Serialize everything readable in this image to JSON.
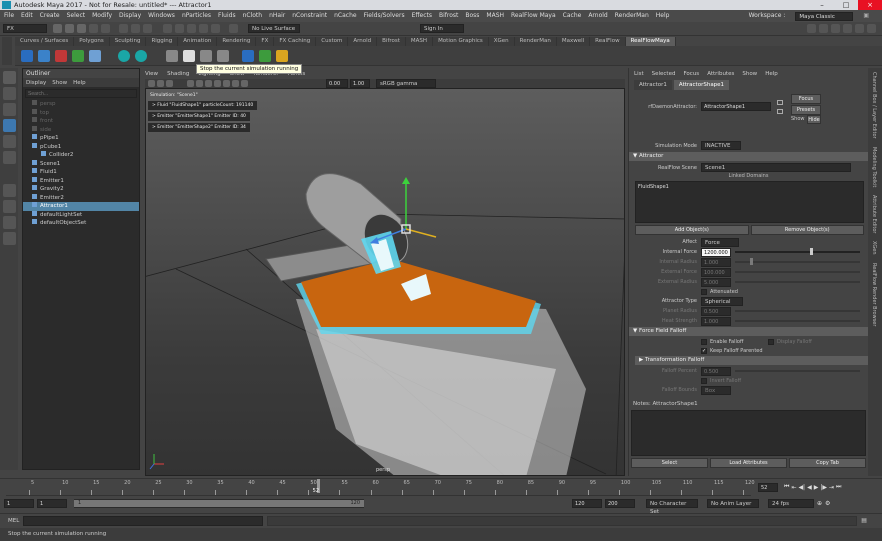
{
  "window": {
    "title": "Autodesk Maya 2017 - Not for Resale: untitled* --- Attractor1"
  },
  "menubar": [
    "File",
    "Edit",
    "Create",
    "Select",
    "Modify",
    "Display",
    "Windows",
    "nParticles",
    "Fluids",
    "nCloth",
    "nHair",
    "nConstraint",
    "nCache",
    "Fields/Solvers",
    "Effects",
    "Bifrost",
    "Boss",
    "MASH",
    "RealFlow Maya",
    "Cache",
    "Arnold",
    "RenderMan",
    "Help"
  ],
  "workspace": {
    "label": "Workspace :",
    "value": "Maya Classic"
  },
  "statusline": {
    "mode": "FX",
    "live_surface": "No Live Surface",
    "sign_in": "Sign In"
  },
  "shelf_tabs": [
    "Curves / Surfaces",
    "Polygons",
    "Sculpting",
    "Rigging",
    "Animation",
    "Rendering",
    "FX",
    "FX Caching",
    "Custom",
    "Arnold",
    "Bifrost",
    "MASH",
    "Motion Graphics",
    "XGen",
    "RenderMan",
    "Maxwell",
    "RealFlow",
    "RealFlowMaya"
  ],
  "shelf_active_tab": "RealFlowMaya",
  "tooltip": "Stop the current simulation running",
  "outliner": {
    "title": "Outliner",
    "menu": [
      "Display",
      "Show",
      "Help"
    ],
    "search_placeholder": "Search...",
    "items": [
      {
        "label": "persp",
        "indent": 1,
        "state": "dim"
      },
      {
        "label": "top",
        "indent": 1,
        "state": "dim"
      },
      {
        "label": "front",
        "indent": 1,
        "state": "dim"
      },
      {
        "label": "side",
        "indent": 1,
        "state": "dim"
      },
      {
        "label": "pPipe1",
        "indent": 1,
        "state": ""
      },
      {
        "label": "pCube1",
        "indent": 1,
        "state": ""
      },
      {
        "label": "Collider2",
        "indent": 2,
        "state": ""
      },
      {
        "label": "Scene1",
        "indent": 1,
        "state": ""
      },
      {
        "label": "Fluid1",
        "indent": 1,
        "state": ""
      },
      {
        "label": "Emitter1",
        "indent": 1,
        "state": ""
      },
      {
        "label": "Gravity2",
        "indent": 1,
        "state": ""
      },
      {
        "label": "Emitter2",
        "indent": 1,
        "state": ""
      },
      {
        "label": "Attractor1",
        "indent": 1,
        "state": "sel"
      },
      {
        "label": "defaultLightSet",
        "indent": 1,
        "state": ""
      },
      {
        "label": "defaultObjectSet",
        "indent": 1,
        "state": ""
      }
    ]
  },
  "viewport": {
    "menu": [
      "View",
      "Shading",
      "Lighting",
      "Show",
      "Renderer",
      "Panels"
    ],
    "gamma": "sRGB gamma",
    "val1": "0.00",
    "val2": "1.00",
    "hud_sim": "Simulation: \"Scene1\"",
    "hud_lines": [
      "> Fluid \"FluidShape1\" particleCount: 191140",
      "> Emitter \"EmitterShape1\" Emitter ID: 40",
      "> Emitter \"EmitterShape2\" Emitter ID: 34"
    ],
    "cam_label": "persp"
  },
  "attr_editor": {
    "menu": [
      "List",
      "Selected",
      "Focus",
      "Attributes",
      "Show",
      "Help"
    ],
    "tabs": [
      "Attractor1",
      "AttractorShape1"
    ],
    "node_label": "rfDaemonAttractor:",
    "node_value": "AttractorShape1",
    "focus_btn": "Focus",
    "presets_btn": "Presets",
    "show_btn": "Show",
    "hide_btn": "Hide",
    "sim_mode_label": "Simulation Mode",
    "sim_mode_value": "INACTIVE",
    "section_attractor": "Attractor",
    "scene_label": "RealFlow Scene",
    "scene_value": "Scene1",
    "linked_label": "Linked Domains",
    "linked_items": [
      "FluidShape1"
    ],
    "add_btn": "Add Object(s)",
    "remove_btn": "Remove Object(s)",
    "affect_label": "Affect",
    "affect_value": "Force",
    "internal_force_label": "Internal Force",
    "internal_force_value": "1200.000",
    "internal_force_fraction": 0.6,
    "internal_radius_label": "Internal Radius",
    "internal_radius_value": "1.000",
    "external_force_label": "External Force",
    "external_force_value": "100.000",
    "external_radius_label": "External Radius",
    "external_radius_value": "5.000",
    "attenuated_label": "Attenuated",
    "attractor_type_label": "Attractor Type",
    "attractor_type_value": "Spherical",
    "planet_radius_label": "Planet Radius",
    "planet_radius_value": "0.500",
    "heat_strength_label": "Heat Strength",
    "heat_strength_value": "1.000",
    "section_falloff": "Force Field Falloff",
    "enable_falloff": "Enable Falloff",
    "display_falloff": "Display Falloff",
    "keep_falloff": "Keep Falloff Parented",
    "section_transform": "Transformation Falloff",
    "falloff_percent_label": "Falloff Percent",
    "falloff_percent_value": "0.500",
    "invert_falloff": "Invert Falloff",
    "falloff_bounds_label": "Falloff Bounds",
    "falloff_bounds_value": "Box",
    "notes_label": "Notes:  AttractorShape1",
    "select_btn": "Select",
    "load_btn": "Load Attributes",
    "copy_btn": "Copy Tab"
  },
  "side_tabs": [
    "Channel Box / Layer Editor",
    "Modeling Toolkit",
    "Attribute Editor",
    "XGen",
    "RealFlow Render Browser"
  ],
  "time": {
    "ticks": [
      "5",
      "10",
      "15",
      "20",
      "25",
      "30",
      "35",
      "40",
      "45",
      "50",
      "55",
      "60",
      "65",
      "70",
      "75",
      "80",
      "85",
      "90",
      "95",
      "100",
      "105",
      "110",
      "115",
      "120"
    ],
    "current": "52",
    "current_fraction": 0.417,
    "field": "52"
  },
  "range": {
    "start": "1",
    "start2": "1",
    "inner_start": "1",
    "inner_end": "120",
    "end": "120",
    "end2": "200",
    "char_set": "No Character Set",
    "anim_layer": "No Anim Layer",
    "fps": "24 fps"
  },
  "cmdline": {
    "label": "MEL"
  },
  "helpline": "Stop the current simulation running",
  "colors": {
    "accent": "#5285a6",
    "fluid_orange": "#c8650f",
    "foam_cyan": "#5fd7ef"
  }
}
